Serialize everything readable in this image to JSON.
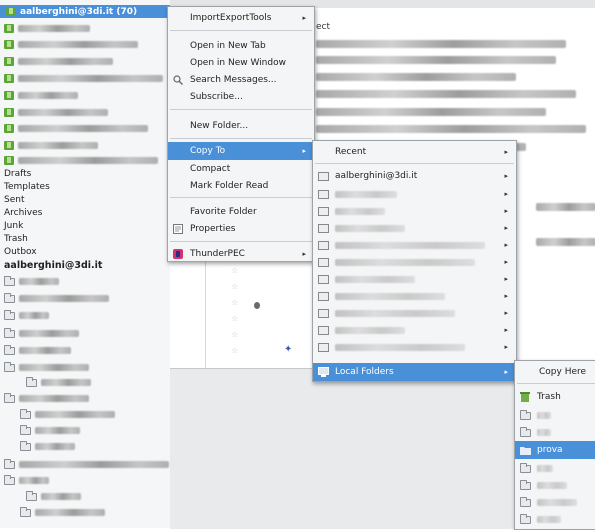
{
  "folder_pane": {
    "account_selected": "aalberghini@3di.it (70)",
    "special_folders": [
      "Drafts",
      "Templates",
      "Sent",
      "Archives",
      "Junk",
      "Trash",
      "Outbox"
    ],
    "account2": "aalberghini@3di.it"
  },
  "thread_pane": {
    "subject_header": "ect"
  },
  "context_menu": {
    "items": [
      "ImportExportTools",
      "Open in New Tab",
      "Open in New Window",
      "Search Messages...",
      "Subscribe...",
      "New Folder...",
      "Copy To",
      "Compact",
      "Mark Folder Read",
      "Favorite Folder",
      "Properties",
      "ThunderPEC"
    ]
  },
  "copyto_menu": {
    "items": [
      "Recent",
      "aalberghini@3di.it",
      "Local Folders"
    ]
  },
  "local_folders_menu": {
    "items": [
      "Copy Here",
      "Trash",
      "prova"
    ]
  },
  "colors": {
    "highlight": "#4a90d9",
    "menu_bg": "#f4f5f6",
    "pane_bg": "#f5f6f7"
  }
}
